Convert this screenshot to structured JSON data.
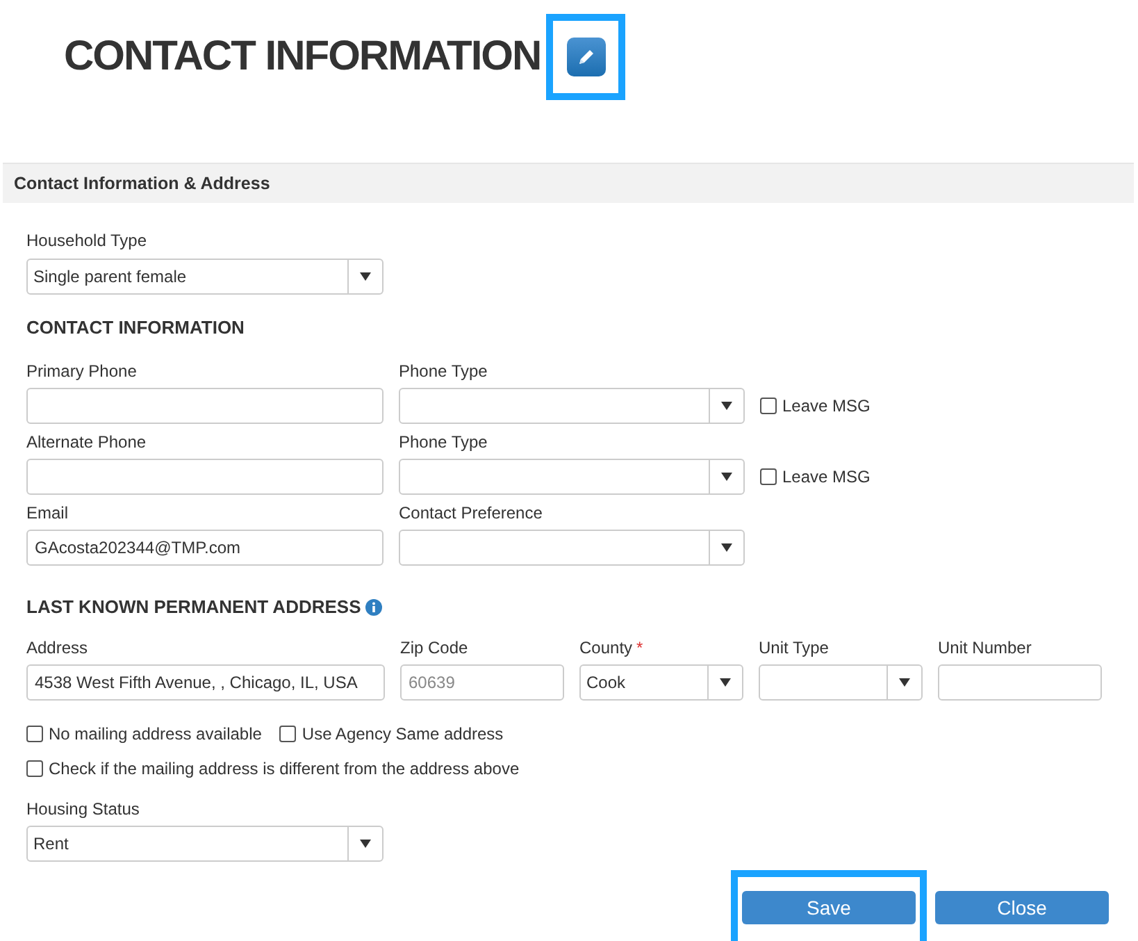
{
  "title": "CONTACT INFORMATION",
  "edit_button": {
    "highlighted": true
  },
  "section_header": "Contact Information & Address",
  "household_type": {
    "label": "Household Type",
    "value": "Single parent female"
  },
  "contact_heading": "CONTACT INFORMATION",
  "contact_rows": [
    {
      "field": {
        "label": "Primary Phone"
      },
      "select": {
        "label": "Phone Type"
      },
      "leave_msg": {
        "label": "Leave MSG",
        "checked": false
      }
    },
    {
      "field": {
        "label": "Alternate Phone"
      },
      "select": {
        "label": "Phone Type"
      },
      "leave_msg": {
        "label": "Leave MSG",
        "checked": false
      }
    },
    {
      "field": {
        "label": "Email",
        "value": "GAcosta202344@TMP.com"
      },
      "select": {
        "label": "Contact Preference"
      }
    }
  ],
  "address_heading": "LAST KNOWN PERMANENT ADDRESS",
  "address_fields": [
    {
      "kind": "text",
      "label": "Address",
      "value": "4538 West Fifth Avenue, , Chicago, IL, USA"
    },
    {
      "kind": "text",
      "label": "Zip Code",
      "placeholder": "60639"
    },
    {
      "kind": "select",
      "label": "County",
      "value": "Cook",
      "required_mark": "*"
    },
    {
      "kind": "select",
      "label": "Unit Type"
    },
    {
      "kind": "text",
      "label": "Unit Number"
    }
  ],
  "mailing_options": [
    {
      "items": [
        {
          "label": "No mailing address available",
          "checked": false
        },
        {
          "label": "Use Agency Same address",
          "checked": false
        }
      ]
    },
    {
      "items": [
        {
          "label": "Check if the mailing address is different from the address above",
          "checked": false
        }
      ]
    }
  ],
  "housing_status": {
    "label": "Housing Status",
    "value": "Rent"
  },
  "buttons": [
    {
      "label": "Save",
      "highlighted": true
    },
    {
      "label": "Close",
      "highlighted": false
    }
  ]
}
